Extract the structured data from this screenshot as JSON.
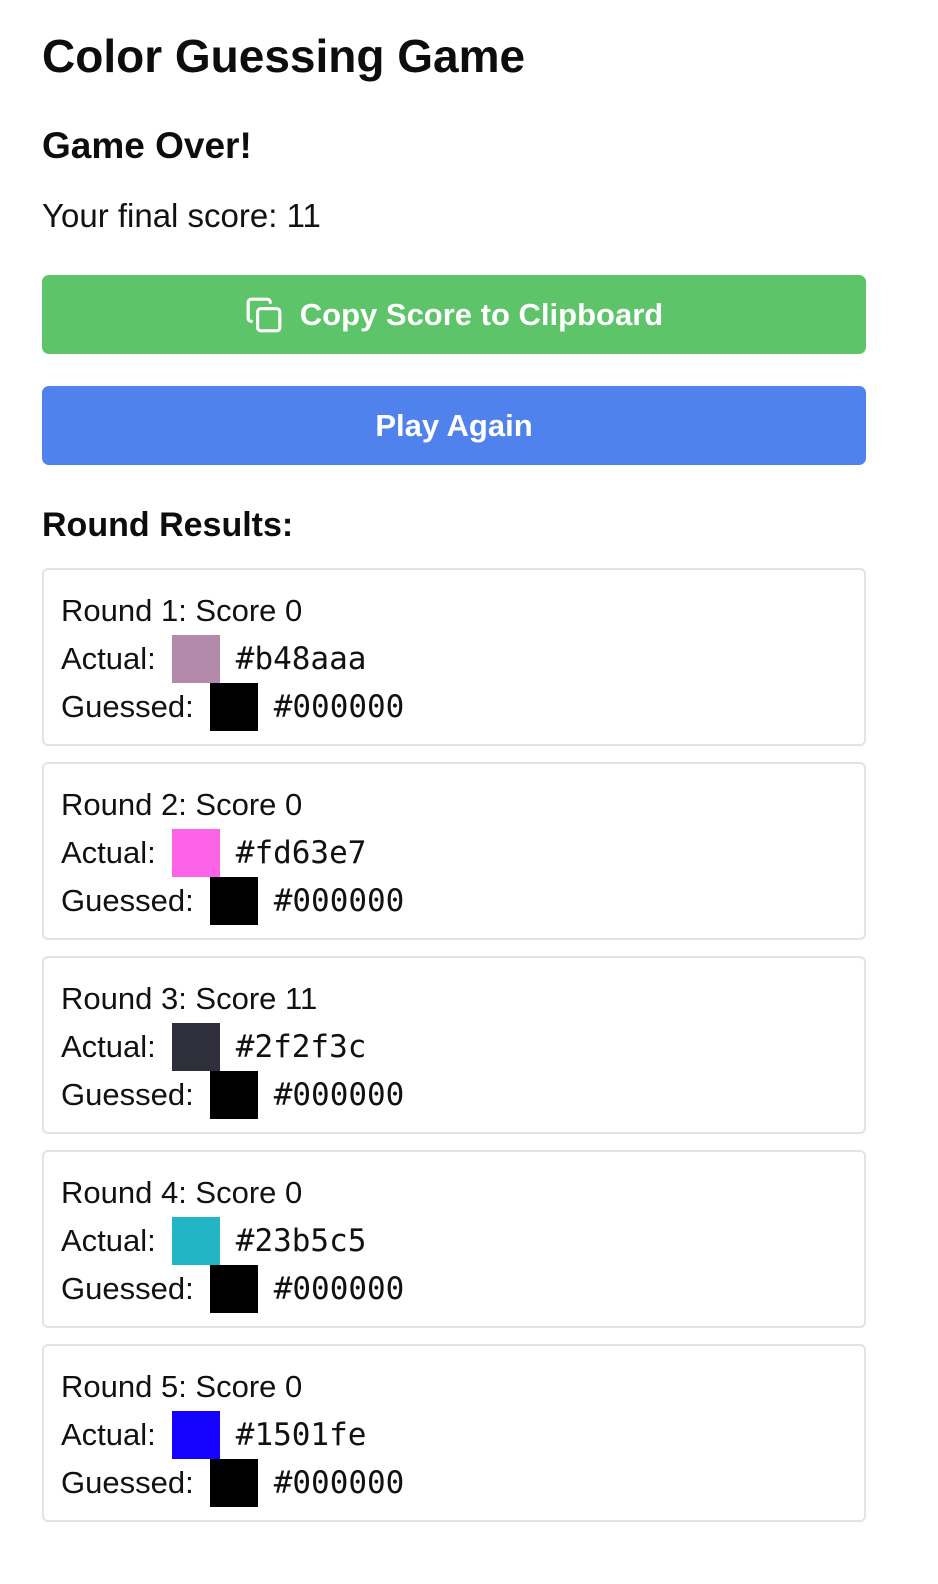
{
  "app": {
    "title": "Color Guessing Game"
  },
  "result": {
    "heading": "Game Over!",
    "final_score_text": "Your final score: 11"
  },
  "buttons": {
    "copy_label": "Copy Score to Clipboard",
    "play_again_label": "Play Again"
  },
  "colors": {
    "copy_button": "#5ec46a",
    "play_button": "#4f82ec"
  },
  "icons": {
    "copy": "copy-icon"
  },
  "round_results": {
    "title": "Round Results:",
    "actual_label": "Actual:",
    "guessed_label": "Guessed:",
    "rounds": [
      {
        "heading": "Round 1: Score 0",
        "actual_hex": "#b48aaa",
        "guessed_hex": "#000000"
      },
      {
        "heading": "Round 2: Score 0",
        "actual_hex": "#fd63e7",
        "guessed_hex": "#000000"
      },
      {
        "heading": "Round 3: Score 11",
        "actual_hex": "#2f2f3c",
        "guessed_hex": "#000000"
      },
      {
        "heading": "Round 4: Score 0",
        "actual_hex": "#23b5c5",
        "guessed_hex": "#000000"
      },
      {
        "heading": "Round 5: Score 0",
        "actual_hex": "#1501fe",
        "guessed_hex": "#000000"
      }
    ]
  }
}
